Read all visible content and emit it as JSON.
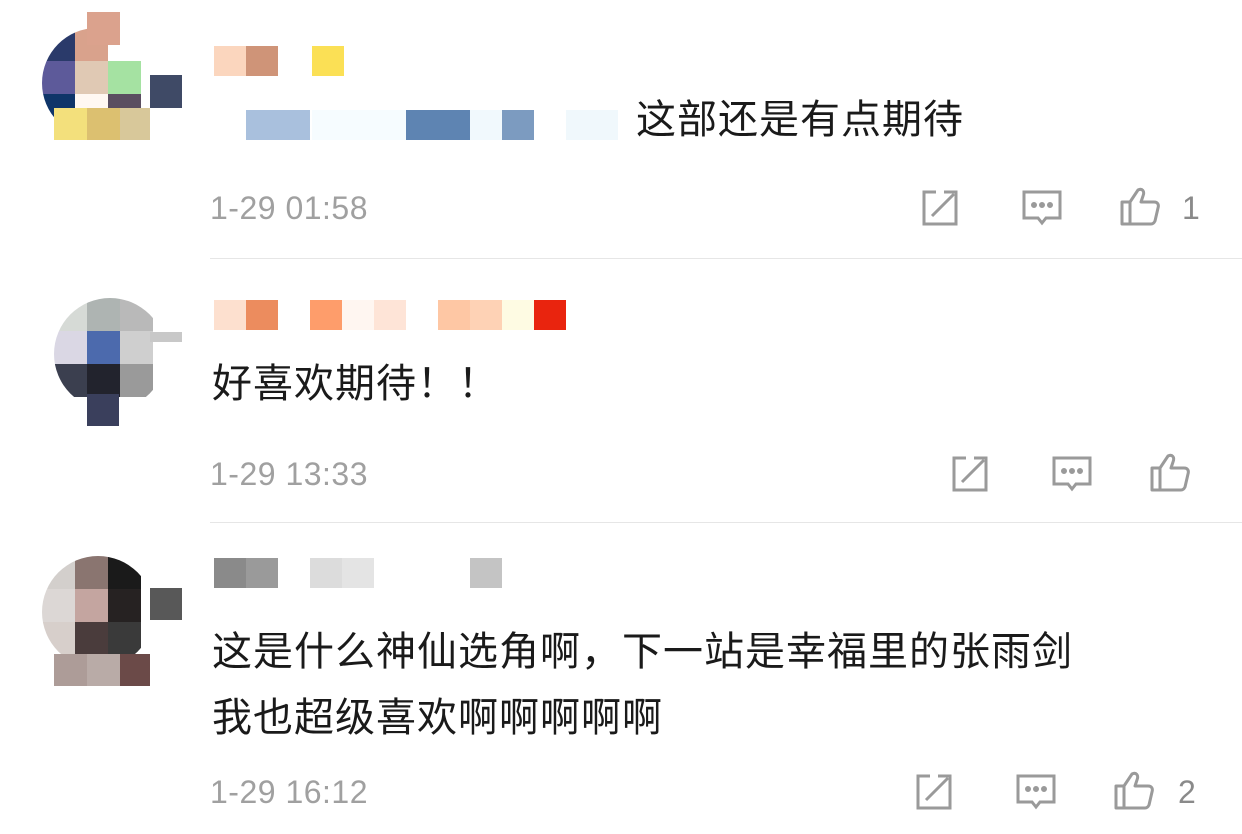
{
  "comments": [
    {
      "text": "这部还是有点期待",
      "time": "1-29 01:58",
      "like_count": "1",
      "icons": [
        "share-icon",
        "comment-icon",
        "like-icon"
      ]
    },
    {
      "text": "好喜欢期待！！",
      "time": "1-29 13:33",
      "like_count": "",
      "icons": [
        "share-icon",
        "comment-icon",
        "like-icon"
      ]
    },
    {
      "text_line1": "这是什么神仙选角啊，下一站是幸福里的张雨剑",
      "text_line2": "我也超级喜欢啊啊啊啊啊",
      "time": "1-29 16:12",
      "like_count": "2",
      "icons": [
        "share-icon",
        "comment-icon",
        "like-icon"
      ]
    }
  ],
  "colors": {
    "text": "#1a1a1a",
    "meta": "#a0a0a0",
    "icon": "#9a9a9a",
    "divider": "#e6e6e6"
  }
}
